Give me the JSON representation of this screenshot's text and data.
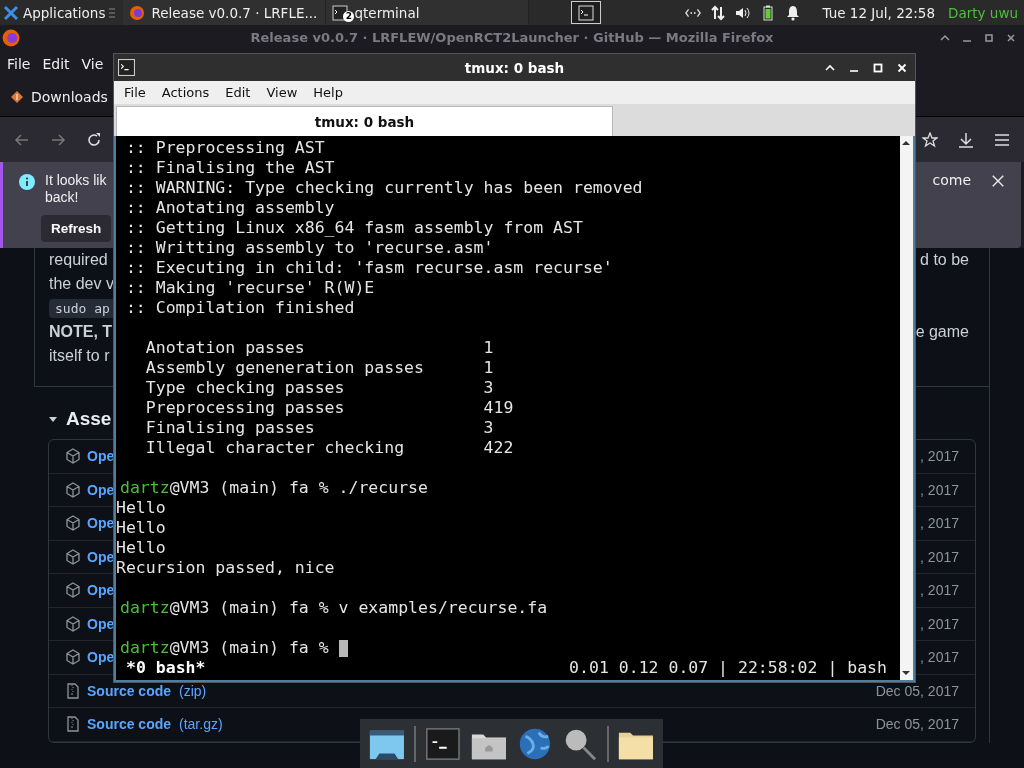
{
  "panel": {
    "apps_label": "Applications",
    "tasks": [
      {
        "kind": "browser",
        "label": "Release v0.0.7 · LRFLE..."
      },
      {
        "kind": "terminal",
        "label": "qterminal",
        "badge": "2"
      }
    ],
    "clock": "Tue 12 Jul, 22:58",
    "user": "Darty uwu"
  },
  "browser": {
    "title": "Release v0.0.7 · LRFLEW/OpenRCT2Launcher · GitHub — Mozilla Firefox",
    "menu": [
      "File",
      "Edit",
      "Vie"
    ],
    "bookmark": "Downloads",
    "notice": {
      "text_start": "It looks lik",
      "text_end": "come",
      "line2": "back!",
      "button": "Refresh"
    },
    "paragraph": [
      {
        "kind": "text",
        "left": "required",
        "right": "d to be"
      },
      {
        "kind": "text",
        "left": "the dev v"
      },
      {
        "kind": "code",
        "left": "sudo ap"
      },
      {
        "kind": "note",
        "left": "NOTE, T",
        "right": "e game"
      },
      {
        "kind": "text",
        "left": "itself to r"
      }
    ],
    "assets": {
      "heading": "Asse",
      "expanded": true,
      "rows": [
        {
          "kind": "package",
          "name": "Ope",
          "date": ", 2017"
        },
        {
          "kind": "package",
          "name": "Ope",
          "date": ", 2017"
        },
        {
          "kind": "package",
          "name": "Ope",
          "date": ", 2017"
        },
        {
          "kind": "package",
          "name": "Ope",
          "date": ", 2017"
        },
        {
          "kind": "package",
          "name": "Ope",
          "date": ", 2017"
        },
        {
          "kind": "package",
          "name": "Ope",
          "date": ", 2017"
        },
        {
          "kind": "package",
          "name": "Ope",
          "date": ", 2017"
        },
        {
          "kind": "source",
          "name": "Source code",
          "format": "(zip)",
          "date": "Dec 05, 2017"
        },
        {
          "kind": "source",
          "name": "Source code",
          "format": "(tar.gz)",
          "date": "Dec 05, 2017"
        }
      ]
    }
  },
  "terminal": {
    "title": "tmux: 0 bash",
    "menu": [
      "File",
      "Actions",
      "Edit",
      "View",
      "Help"
    ],
    "tabs": [
      {
        "label": "tmux: 0 bash",
        "selected": true
      }
    ],
    "lines": [
      {
        "kind": "output",
        "text": " :: Preprocessing AST"
      },
      {
        "kind": "output",
        "text": " :: Finalising the AST"
      },
      {
        "kind": "output",
        "text": " :: WARNING: Type checking currently has been removed"
      },
      {
        "kind": "output",
        "text": " :: Anotating assembly"
      },
      {
        "kind": "output",
        "text": " :: Getting Linux x86_64 fasm assembly from AST"
      },
      {
        "kind": "output",
        "text": " :: Writting assembly to 'recurse.asm'"
      },
      {
        "kind": "output",
        "text": " :: Executing in child: 'fasm recurse.asm recurse'"
      },
      {
        "kind": "output",
        "text": " :: Making 'recurse' R(W)E"
      },
      {
        "kind": "output",
        "text": " :: Compilation finished"
      },
      {
        "kind": "blank"
      },
      {
        "kind": "stat",
        "label": "Anotation passes",
        "value": "1"
      },
      {
        "kind": "stat",
        "label": "Assembly geneneration passes",
        "value": "1"
      },
      {
        "kind": "stat",
        "label": "Type checking passes",
        "value": "3"
      },
      {
        "kind": "stat",
        "label": "Preprocessing passes",
        "value": "419"
      },
      {
        "kind": "stat",
        "label": "Finalising passes",
        "value": "3"
      },
      {
        "kind": "stat",
        "label": "Illegal character checking",
        "value": "422"
      },
      {
        "kind": "blank"
      },
      {
        "kind": "prompt",
        "user": "dartz",
        "rest": "@VM3 (main) fa % ./recurse",
        "cursor": false
      },
      {
        "kind": "output",
        "text": "Hello"
      },
      {
        "kind": "output",
        "text": "Hello"
      },
      {
        "kind": "output",
        "text": "Hello"
      },
      {
        "kind": "output",
        "text": "Recursion passed, nice"
      },
      {
        "kind": "blank"
      },
      {
        "kind": "prompt",
        "user": "dartz",
        "rest": "@VM3 (main) fa % v examples/recurse.fa",
        "cursor": false
      },
      {
        "kind": "blank"
      },
      {
        "kind": "prompt",
        "user": "dartz",
        "rest": "@VM3 (main) fa %",
        "cursor": true
      }
    ],
    "status": {
      "left": "*0 bash*",
      "right": "0.01 0.12 0.07 | 22:58:02 | bash"
    }
  }
}
